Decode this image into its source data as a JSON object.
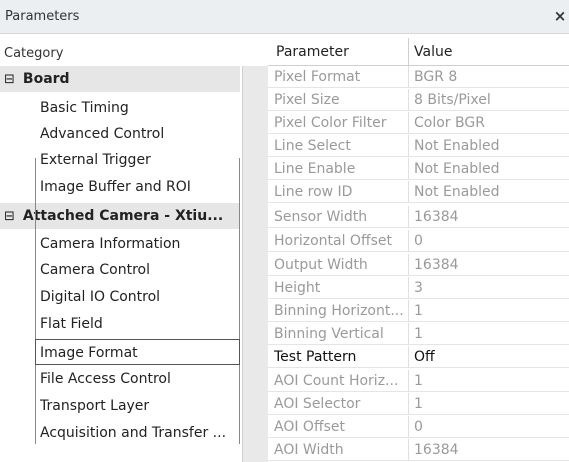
{
  "window": {
    "title": "Parameters",
    "close_glyph": "×"
  },
  "category": {
    "header": "Category",
    "groups": [
      {
        "label": "Board",
        "toggle": "⊟",
        "items": [
          "Basic Timing",
          "Advanced Control",
          "External Trigger",
          "Image Buffer and ROI"
        ]
      },
      {
        "label": "Attached Camera - Xtiu...",
        "toggle": "⊟",
        "items": [
          "Camera Information",
          "Camera Control",
          "Digital IO Control",
          "Flat Field",
          "Image Format",
          "File Access Control",
          "Transport Layer",
          "Acquisition and Transfer ..."
        ]
      }
    ],
    "selected": "Image Format"
  },
  "grid": {
    "header_parameter": "Parameter",
    "header_value": "Value",
    "rows": [
      {
        "name": "Pixel Format",
        "value": "BGR 8"
      },
      {
        "name": "Pixel Size",
        "value": "8 Bits/Pixel"
      },
      {
        "name": "Pixel Color Filter",
        "value": "Color BGR"
      },
      {
        "name": "Line Select",
        "value": "Not Enabled"
      },
      {
        "name": "Line Enable",
        "value": "Not Enabled"
      },
      {
        "name": "Line row ID",
        "value": "Not Enabled"
      },
      {
        "name": "Sensor Width",
        "value": "16384"
      },
      {
        "name": "Horizontal Offset",
        "value": "0"
      },
      {
        "name": "Output Width",
        "value": "16384"
      },
      {
        "name": "Height",
        "value": "3"
      },
      {
        "name": "Binning Horizont...",
        "value": "1"
      },
      {
        "name": "Binning Vertical",
        "value": "1"
      },
      {
        "name": "Test Pattern",
        "value": "Off",
        "editable": true
      },
      {
        "name": "AOI Count Horiz...",
        "value": "1"
      },
      {
        "name": "AOI Selector",
        "value": "1"
      },
      {
        "name": "AOI Offset",
        "value": "0"
      },
      {
        "name": "AOI Width",
        "value": "16384"
      }
    ]
  },
  "colors": {
    "titlebar_bg": "#eceff1",
    "group_bg": "#e6e6e6",
    "disabled_text": "#9a9a9a",
    "enabled_text": "#111111"
  }
}
